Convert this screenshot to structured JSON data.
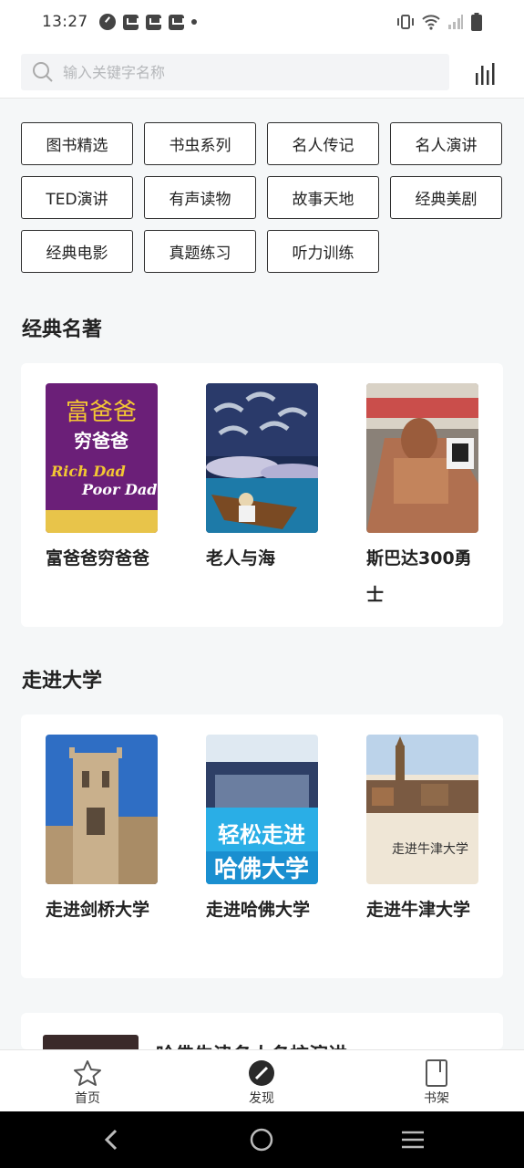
{
  "status": {
    "time": "13:27"
  },
  "search": {
    "placeholder": "输入关键字名称"
  },
  "tags": [
    "图书精选",
    "书虫系列",
    "名人传记",
    "名人演讲",
    "TED演讲",
    "有声读物",
    "故事天地",
    "经典美剧",
    "经典电影",
    "真题练习",
    "听力训练"
  ],
  "sections": [
    {
      "title": "经典名著",
      "books": [
        "富爸爸穷爸爸",
        "老人与海",
        "斯巴达300勇士"
      ]
    },
    {
      "title": "走进大学",
      "books": [
        "走进剑桥大学",
        "走进哈佛大学",
        "走进牛津大学"
      ]
    }
  ],
  "covers": {
    "rich_dad_title": "富爸爸",
    "rich_dad_sub": "穷爸爸",
    "rich_dad_en1": "Rich Dad",
    "rich_dad_en2": "Poor Dad",
    "harvard_line1": "轻松走进",
    "harvard_line2": "哈佛大学",
    "oxford_text": "走进牛津大学"
  },
  "partial_item": {
    "title": "哈佛牛津名人名校演讲"
  },
  "nav": {
    "home": "首页",
    "discover": "发现",
    "shelf": "书架"
  },
  "colors": {
    "accent": "#2e2e2e",
    "background": "#f5f7f8"
  }
}
